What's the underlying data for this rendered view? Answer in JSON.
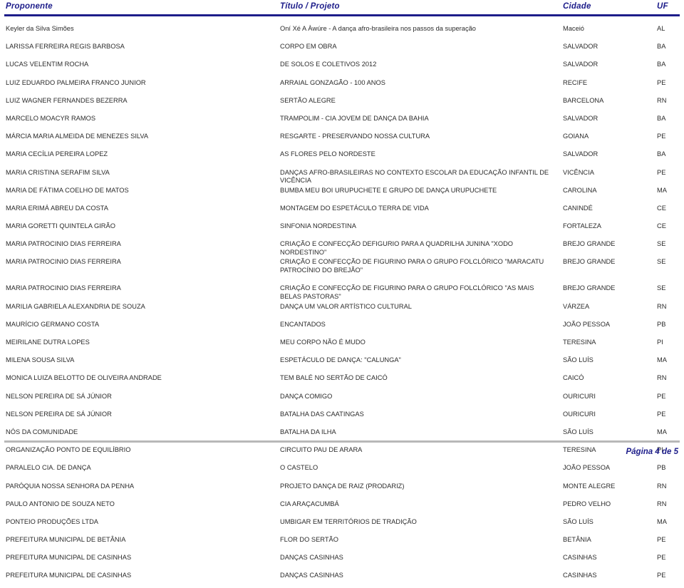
{
  "document": {
    "header_color": "#1d1d8a",
    "footer_rule_color": "#b8b8b8"
  },
  "table": {
    "columns": {
      "proponente": "Proponente",
      "titulo": "Título / Projeto",
      "cidade": "Cidade",
      "uf": "UF"
    },
    "rows": [
      {
        "proponente": "Keyler da Silva Simões",
        "titulo": "Oní Xé A Àwúre - A dança afro-brasileira nos passos da superação",
        "cidade": "Maceió",
        "uf": "AL"
      },
      {
        "proponente": "LARISSA FERREIRA REGIS BARBOSA",
        "titulo": "CORPO EM OBRA",
        "cidade": "SALVADOR",
        "uf": "BA"
      },
      {
        "proponente": "LUCAS VELENTIM ROCHA",
        "titulo": "DE SOLOS E COLETIVOS 2012",
        "cidade": "SALVADOR",
        "uf": "BA"
      },
      {
        "proponente": "LUIZ EDUARDO PALMEIRA FRANCO JUNIOR",
        "titulo": "ARRAIAL GONZAGÃO - 100 ANOS",
        "cidade": "RECIFE",
        "uf": "PE"
      },
      {
        "proponente": "LUIZ WAGNER FERNANDES BEZERRA",
        "titulo": "SERTÃO ALEGRE",
        "cidade": "BARCELONA",
        "uf": "RN"
      },
      {
        "proponente": "MARCELO MOACYR RAMOS",
        "titulo": "TRAMPOLIM - CIA JOVEM DE DANÇA DA BAHIA",
        "cidade": "SALVADOR",
        "uf": "BA"
      },
      {
        "proponente": "MÁRCIA MARIA ALMEIDA DE MENEZES SILVA",
        "titulo": "RESGARTE - PRESERVANDO NOSSA CULTURA",
        "cidade": "GOIANA",
        "uf": "PE"
      },
      {
        "proponente": "MARIA CECÍLIA PEREIRA LOPEZ",
        "titulo": "AS FLORES PELO NORDESTE",
        "cidade": "SALVADOR",
        "uf": "BA"
      },
      {
        "proponente": "MARIA CRISTINA SERAFIM SILVA",
        "titulo": "DANÇAS AFRO-BRASILEIRAS NO CONTEXTO ESCOLAR DA EDUCAÇÃO INFANTIL DE VICÊNCIA",
        "cidade": "VICÊNCIA",
        "uf": "PE"
      },
      {
        "proponente": "MARIA DE FÁTIMA COELHO DE MATOS",
        "titulo": "BUMBA MEU BOI URUPUCHETE E GRUPO DE DANÇA URUPUCHETE",
        "cidade": "CAROLINA",
        "uf": "MA"
      },
      {
        "proponente": "MARIA ERIMÁ ABREU DA COSTA",
        "titulo": "MONTAGEM DO ESPETÁCULO TERRA DE VIDA",
        "cidade": "CANINDÉ",
        "uf": "CE"
      },
      {
        "proponente": "MARIA GORETTI QUINTELA GIRÃO",
        "titulo": "SINFONIA NORDESTINA",
        "cidade": "FORTALEZA",
        "uf": "CE"
      },
      {
        "proponente": "MARIA PATROCINIO DIAS FERREIRA",
        "titulo": "CRIAÇÃO E CONFECÇÃO DEFIGURIO PARA A QUADRILHA JUNINA \"XODO NORDESTINO\"",
        "cidade": "BREJO GRANDE",
        "uf": "SE"
      },
      {
        "proponente": "MARIA PATROCINIO DIAS FERREIRA",
        "titulo": "CRIAÇÃO E CONFECÇÃO DE FIGURINO PARA O GRUPO FOLCLÓRICO \"MARACATU PATROCÍNIO DO BREJÃO\"",
        "cidade": "BREJO GRANDE",
        "uf": "SE",
        "tall": true
      },
      {
        "proponente": "MARIA PATROCINIO DIAS FERREIRA",
        "titulo": "CRIAÇÃO E CONFECÇÃO DE FIGURINO PARA O GRUPO FOLCLÓRICO \"AS MAIS BELAS PASTORAS\"",
        "cidade": "BREJO GRANDE",
        "uf": "SE"
      },
      {
        "proponente": "MARILIA GABRIELA ALEXANDRIA DE SOUZA",
        "titulo": "DANÇA UM VALOR ARTÍSTICO CULTURAL",
        "cidade": "VÁRZEA",
        "uf": "RN"
      },
      {
        "proponente": "MAURÍCIO GERMANO COSTA",
        "titulo": "ENCANTADOS",
        "cidade": "JOÃO PESSOA",
        "uf": "PB"
      },
      {
        "proponente": "MEIRILANE DUTRA LOPES",
        "titulo": "MEU CORPO NÃO É MUDO",
        "cidade": "TERESINA",
        "uf": "PI"
      },
      {
        "proponente": "MILENA SOUSA SILVA",
        "titulo": "ESPETÁCULO DE DANÇA: \"CALUNGA\"",
        "cidade": "SÃO LUÍS",
        "uf": "MA"
      },
      {
        "proponente": "MONICA LUIZA BELOTTO DE OLIVEIRA ANDRADE",
        "titulo": "TEM BALÉ NO SERTÃO DE CAICÓ",
        "cidade": "CAICÓ",
        "uf": "RN"
      },
      {
        "proponente": "NELSON PEREIRA DE SÁ JÚNIOR",
        "titulo": "DANÇA COMIGO",
        "cidade": "OURICURI",
        "uf": "PE"
      },
      {
        "proponente": "NELSON PEREIRA DE SÁ JÚNIOR",
        "titulo": "BATALHA DAS CAATINGAS",
        "cidade": "OURICURI",
        "uf": "PE"
      },
      {
        "proponente": "NÓS DA COMUNIDADE",
        "titulo": "BATALHA DA ILHA",
        "cidade": "SÃO LUÍS",
        "uf": "MA"
      },
      {
        "proponente": "ORGANIZAÇÃO PONTO DE EQUILÍBRIO",
        "titulo": "CIRCUITO PAU DE ARARA",
        "cidade": "TERESINA",
        "uf": "PI"
      },
      {
        "proponente": "PARALELO CIA. DE DANÇA",
        "titulo": "O CASTELO",
        "cidade": "JOÃO PESSOA",
        "uf": "PB"
      },
      {
        "proponente": "PARÓQUIA NOSSA SENHORA DA PENHA",
        "titulo": "PROJETO DANÇA DE RAIZ (PRODARIZ)",
        "cidade": "MONTE ALEGRE",
        "uf": "RN"
      },
      {
        "proponente": "PAULO ANTONIO DE SOUZA NETO",
        "titulo": "CIA ARAÇACUMBÁ",
        "cidade": "PEDRO VELHO",
        "uf": "RN"
      },
      {
        "proponente": "PONTEIO PRODUÇÕES LTDA",
        "titulo": "UMBIGAR EM TERRITÓRIOS DE TRADIÇÃO",
        "cidade": "SÃO LUÍS",
        "uf": "MA"
      },
      {
        "proponente": "PREFEITURA MUNICIPAL DE BETÂNIA",
        "titulo": "FLOR DO SERTÃO",
        "cidade": "BETÂNIA",
        "uf": "PE"
      },
      {
        "proponente": "PREFEITURA MUNICIPAL DE CASINHAS",
        "titulo": "DANÇAS CASINHAS",
        "cidade": "CASINHAS",
        "uf": "PE"
      },
      {
        "proponente": "PREFEITURA MUNICIPAL DE CASINHAS",
        "titulo": "DANÇAS CASINHAS",
        "cidade": "CASINHAS",
        "uf": "PE"
      }
    ]
  },
  "footer": {
    "page_label": "Página 4 de 5"
  }
}
